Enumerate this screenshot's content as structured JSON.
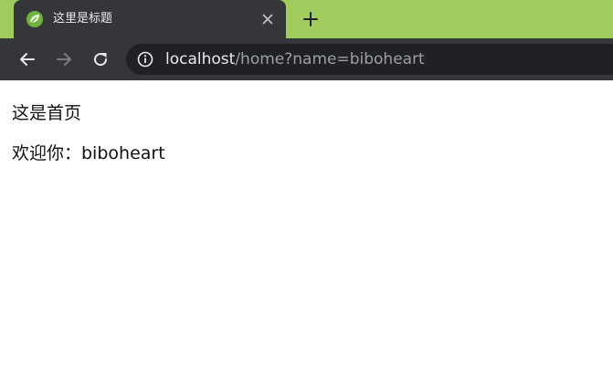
{
  "browser": {
    "tab": {
      "title": "这里是标题",
      "favicon": "spring-leaf-icon",
      "close_icon": "close-icon"
    },
    "new_tab_icon": "plus-icon",
    "toolbar": {
      "back_icon": "arrow-left-icon",
      "forward_icon": "arrow-right-icon",
      "reload_icon": "reload-icon",
      "info_icon": "info-icon"
    },
    "address_bar": {
      "host": "localhost",
      "path": "/home?name=biboheart"
    },
    "colors": {
      "tabstrip": "#9fcc5c",
      "tab": "#35363a",
      "toolbar": "#35363a",
      "omnibox": "#202124",
      "favicon": "#6db33f"
    }
  },
  "page": {
    "heading": "这是首页",
    "welcome": "欢迎你：biboheart"
  }
}
